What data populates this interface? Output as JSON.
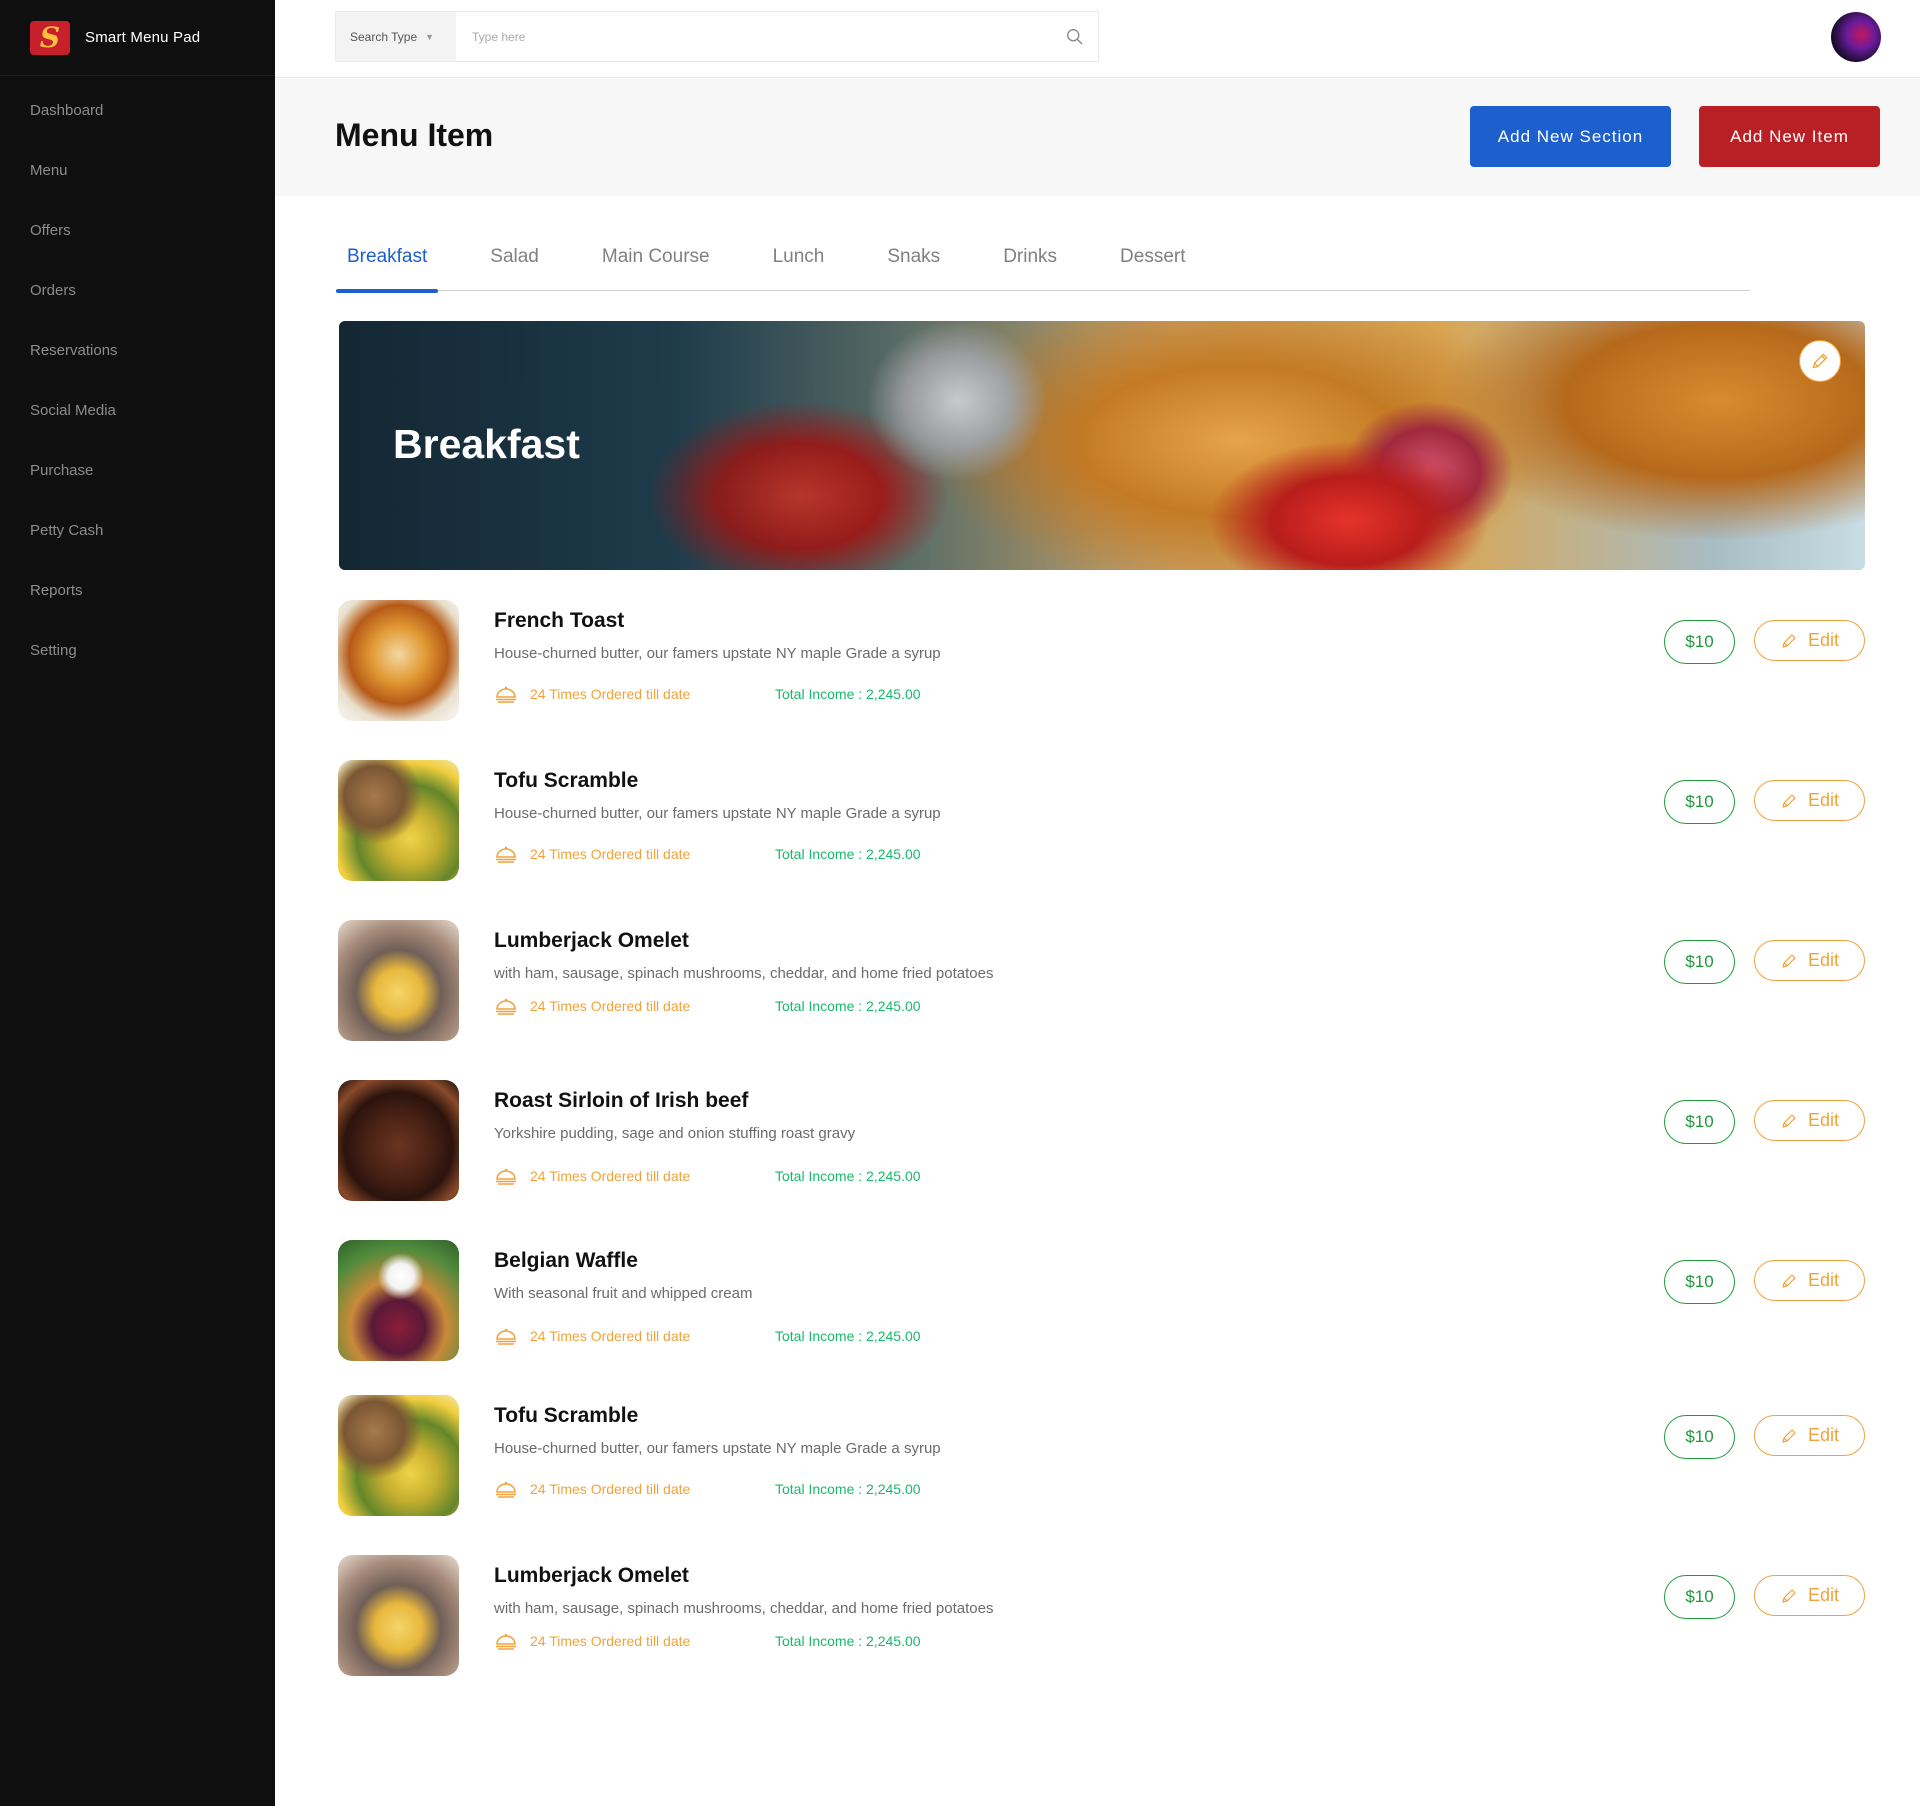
{
  "app": {
    "name": "Smart Menu Pad",
    "logo_glyph": "S"
  },
  "sidebar": {
    "items": [
      {
        "label": "Dashboard"
      },
      {
        "label": "Menu"
      },
      {
        "label": "Offers"
      },
      {
        "label": "Orders"
      },
      {
        "label": "Reservations"
      },
      {
        "label": "Social Media"
      },
      {
        "label": "Purchase"
      },
      {
        "label": "Petty Cash"
      },
      {
        "label": "Reports"
      },
      {
        "label": "Setting"
      }
    ]
  },
  "search": {
    "type_label": "Search Type",
    "placeholder": "Type here",
    "value": ""
  },
  "header": {
    "title": "Menu Item",
    "add_section_label": "Add New Section",
    "add_item_label": "Add New Item"
  },
  "tabs": [
    {
      "label": "Breakfast",
      "active": true
    },
    {
      "label": "Salad"
    },
    {
      "label": "Main Course"
    },
    {
      "label": "Lunch"
    },
    {
      "label": "Snaks"
    },
    {
      "label": "Drinks"
    },
    {
      "label": "Dessert"
    }
  ],
  "banner": {
    "title": "Breakfast"
  },
  "items": [
    {
      "name": "French Toast",
      "description": "House-churned butter, our famers upstate NY maple Grade a syrup",
      "ordered": "24 Times Ordered till date",
      "income": "Total Income : 2,245.00",
      "price": "$10",
      "edit_label": "Edit"
    },
    {
      "name": "Tofu Scramble",
      "description": "House-churned butter, our famers upstate NY maple Grade a syrup",
      "ordered": "24 Times Ordered till date",
      "income": "Total Income : 2,245.00",
      "price": "$10",
      "edit_label": "Edit"
    },
    {
      "name": "Lumberjack Omelet",
      "description": "with ham, sausage, spinach mushrooms, cheddar, and home fried potatoes",
      "ordered": "24 Times Ordered till date",
      "income": "Total Income : 2,245.00",
      "price": "$10",
      "edit_label": "Edit"
    },
    {
      "name": "Roast Sirloin of Irish beef",
      "description": "Yorkshire pudding, sage and onion stuffing roast gravy",
      "ordered": "24 Times Ordered till date",
      "income": "Total Income : 2,245.00",
      "price": "$10",
      "edit_label": "Edit"
    },
    {
      "name": "Belgian Waffle",
      "description": "With seasonal fruit and whipped cream",
      "ordered": "24 Times Ordered till date",
      "income": "Total Income : 2,245.00",
      "price": "$10",
      "edit_label": "Edit"
    },
    {
      "name": "Tofu Scramble",
      "description": "House-churned butter, our famers upstate NY maple Grade a syrup",
      "ordered": "24 Times Ordered till date",
      "income": "Total Income : 2,245.00",
      "price": "$10",
      "edit_label": "Edit"
    },
    {
      "name": "Lumberjack Omelet",
      "description": "with ham, sausage, spinach mushrooms, cheddar, and home fried potatoes",
      "ordered": "24 Times Ordered till date",
      "income": "Total Income : 2,245.00",
      "price": "$10",
      "edit_label": "Edit"
    }
  ],
  "colors": {
    "sidebar_bg": "#0f0f0f",
    "primary_blue": "#1d5fcc",
    "primary_red": "#b92025",
    "price_green": "#1f9a3a",
    "income_green": "#1ab86c",
    "accent_orange": "#f0a33a"
  },
  "icons": {
    "search": "search-icon",
    "caret": "caret-down-icon",
    "order": "food-tray-icon",
    "edit": "pencil-icon"
  }
}
